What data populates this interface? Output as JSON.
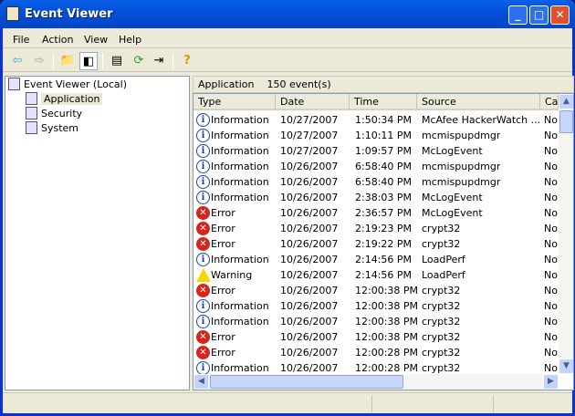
{
  "window": {
    "title": "Event Viewer",
    "icon": "event-viewer-icon",
    "controls": [
      "minimize",
      "maximize",
      "close"
    ]
  },
  "menu": [
    "File",
    "Action",
    "View",
    "Help"
  ],
  "toolbar": [
    "back-arrow-icon",
    "forward-arrow-icon",
    "up-folder-icon",
    "show-hide-tree-icon",
    "properties-icon",
    "refresh-icon",
    "export-list-icon",
    "help-icon"
  ],
  "tree": {
    "root": "Event Viewer (Local)",
    "items": [
      "Application",
      "Security",
      "System"
    ],
    "selected": "Application"
  },
  "header": {
    "log": "Application",
    "count": "150 event(s)"
  },
  "columns": [
    "Type",
    "Date",
    "Time",
    "Source",
    "Ca"
  ],
  "rows": [
    [
      "Information",
      "10/27/2007",
      "1:50:34 PM",
      "McAfee HackerWatch ...",
      "No"
    ],
    [
      "Information",
      "10/27/2007",
      "1:10:11 PM",
      "mcmispupdmgr",
      "No"
    ],
    [
      "Information",
      "10/27/2007",
      "1:09:57 PM",
      "McLogEvent",
      "No"
    ],
    [
      "Information",
      "10/26/2007",
      "6:58:40 PM",
      "mcmispupdmgr",
      "No"
    ],
    [
      "Information",
      "10/26/2007",
      "6:58:40 PM",
      "mcmispupdmgr",
      "No"
    ],
    [
      "Information",
      "10/26/2007",
      "2:38:03 PM",
      "McLogEvent",
      "No"
    ],
    [
      "Error",
      "10/26/2007",
      "2:36:57 PM",
      "McLogEvent",
      "No"
    ],
    [
      "Error",
      "10/26/2007",
      "2:19:23 PM",
      "crypt32",
      "No"
    ],
    [
      "Error",
      "10/26/2007",
      "2:19:22 PM",
      "crypt32",
      "No"
    ],
    [
      "Information",
      "10/26/2007",
      "2:14:56 PM",
      "LoadPerf",
      "No"
    ],
    [
      "Warning",
      "10/26/2007",
      "2:14:56 PM",
      "LoadPerf",
      "No"
    ],
    [
      "Error",
      "10/26/2007",
      "12:00:38 PM",
      "crypt32",
      "No"
    ],
    [
      "Information",
      "10/26/2007",
      "12:00:38 PM",
      "crypt32",
      "No"
    ],
    [
      "Information",
      "10/26/2007",
      "12:00:38 PM",
      "crypt32",
      "No"
    ],
    [
      "Error",
      "10/26/2007",
      "12:00:38 PM",
      "crypt32",
      "No"
    ],
    [
      "Error",
      "10/26/2007",
      "12:00:28 PM",
      "crypt32",
      "No"
    ],
    [
      "Information",
      "10/26/2007",
      "12:00:28 PM",
      "crypt32",
      "No"
    ]
  ]
}
